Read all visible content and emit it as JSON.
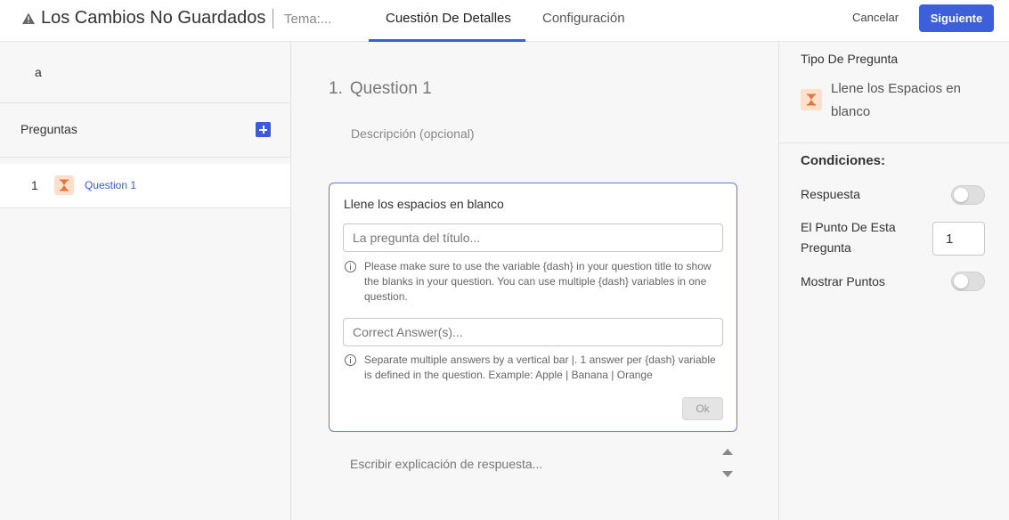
{
  "header": {
    "title": "Los Cambios No Guardados",
    "theme": "Tema:...",
    "tabs": [
      {
        "label": "Cuestión De Detalles",
        "active": true
      },
      {
        "label": "Configuración",
        "active": false
      }
    ],
    "cancel_label": "Cancelar",
    "next_label": "Siguiente",
    "icon": "warning-icon"
  },
  "sidebar": {
    "topic": "a",
    "questions_label": "Preguntas",
    "add_icon": "plus-square-icon",
    "questions": [
      {
        "number": "1",
        "title": "Question 1",
        "icon": "hourglass-icon"
      }
    ]
  },
  "editor": {
    "question_number": "1.",
    "question_title": "Question 1",
    "description_placeholder": "Descripción (opcional)",
    "card": {
      "title": "Llene los espacios en blanco",
      "title_placeholder": "La pregunta del título...",
      "title_hint": "Please make sure to use the variable {dash} in your question title to show the blanks in your question. You can use multiple {dash} variables in one question.",
      "answer_placeholder": "Correct Answer(s)...",
      "answer_hint": "Separate multiple answers by a vertical bar |. 1 answer per {dash} variable is defined in the question. Example: Apple | Banana | Orange",
      "ok_label": "Ok"
    },
    "explanation_placeholder": "Escribir explicación de respuesta..."
  },
  "settings": {
    "type_heading": "Tipo De Pregunta",
    "type_name": "Llene los Espacios en blanco",
    "type_icon": "hourglass-icon",
    "conditions_heading": "Condiciones:",
    "answer_label": "Respuesta",
    "answer_toggle_on": false,
    "points_label": "El Punto De Esta Pregunta",
    "points_value": "1",
    "show_points_label": "Mostrar Puntos",
    "show_points_toggle_on": false
  },
  "colors": {
    "accent": "#3d5fd9",
    "icon_bg": "#fde0cc",
    "icon_fg": "#e8733a"
  }
}
